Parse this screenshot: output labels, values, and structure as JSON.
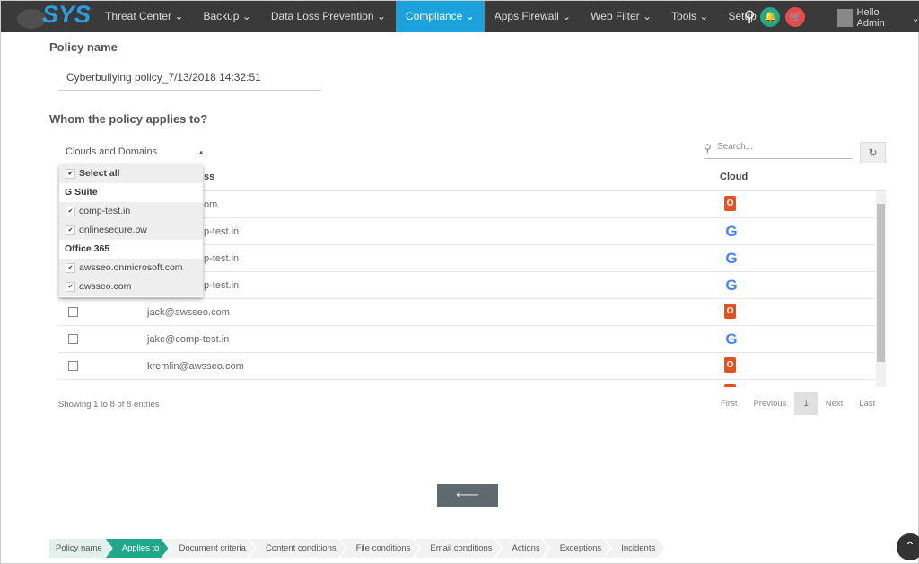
{
  "nav": {
    "logo": "SYS",
    "logo_sub": "CLOUD",
    "items": [
      "Threat Center",
      "Backup",
      "Data Loss Prevention",
      "Compliance",
      "Apps Firewall",
      "Web Filter",
      "Tools",
      "Setup"
    ],
    "active": "Compliance",
    "user": "Hello  Admin"
  },
  "form": {
    "policy_name_label": "Policy name",
    "policy_name_value": "Cyberbullying policy_7/13/2018 14:32:51",
    "applies_label": "Whom the policy applies to?",
    "filter_label": "Clouds and Domains",
    "search_placeholder": "Search..."
  },
  "dropdown": {
    "select_all": "Select all",
    "groups": [
      {
        "name": "G Suite",
        "items": [
          "comp-test.in",
          "onlinesecure.pw"
        ]
      },
      {
        "name": "Office 365",
        "items": [
          "awsseo.onmicrosoft.com",
          "awsseo.com"
        ]
      }
    ]
  },
  "table": {
    "headers": [
      "ss",
      "Cloud"
    ],
    "rows": [
      {
        "email": "om",
        "cloud": "office365"
      },
      {
        "email": "p-test.in",
        "cloud": "google"
      },
      {
        "email": "p-test.in",
        "cloud": "google"
      },
      {
        "email": "p-test.in",
        "cloud": "google"
      },
      {
        "email": "jack@awsseo.com",
        "cloud": "office365"
      },
      {
        "email": "jake@comp-test.in",
        "cloud": "google"
      },
      {
        "email": "kremlin@awsseo.com",
        "cloud": "office365"
      },
      {
        "email": "",
        "cloud": "office365"
      }
    ],
    "info": "Showing 1 to 8 of 8 entries",
    "pagination": [
      "First",
      "Previous",
      "1",
      "Next",
      "Last"
    ],
    "current_page": "1"
  },
  "previous_button": "Previous",
  "steps": [
    "Policy name",
    "Applies to",
    "Document criteria",
    "Content conditions",
    "File conditions",
    "Email conditions",
    "Actions",
    "Exceptions",
    "Incidents"
  ],
  "active_step": "Applies to"
}
